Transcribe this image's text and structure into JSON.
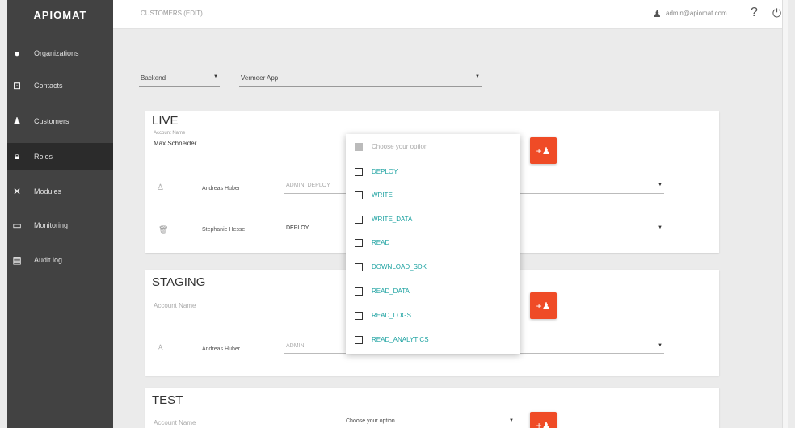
{
  "sidebar": {
    "logo": "APIOMAT",
    "items": [
      {
        "label": "Organizations",
        "icon": "●"
      },
      {
        "label": "Contacts",
        "icon": "⊡"
      },
      {
        "label": "Customers",
        "icon": "♟"
      },
      {
        "label": "Roles",
        "icon": "🔒︎"
      },
      {
        "label": "Modules",
        "icon": "✕"
      },
      {
        "label": "Monitoring",
        "icon": "▭"
      },
      {
        "label": "Audit log",
        "icon": "▤"
      }
    ],
    "active_index": 3
  },
  "header": {
    "breadcrumb": "CUSTOMERS (EDIT)",
    "user_email": "admin@apiomat.com",
    "help_icon": "?",
    "power_icon": "⏻"
  },
  "selectors": {
    "backend": "Backend",
    "app": "Vermeer App",
    "arrow": "▼"
  },
  "live": {
    "title": "LIVE",
    "account_label": "Account Name",
    "account_value": "Max Schneider",
    "rows": [
      {
        "name": "Andreas Huber",
        "role": "ADMIN, DEPLOY"
      },
      {
        "name": "Stephanie Hesse",
        "role": "DEPLOY"
      }
    ]
  },
  "staging": {
    "title": "STAGING",
    "account_placeholder": "Account Name",
    "rows": [
      {
        "name": "Andreas Huber",
        "role": "ADMIN"
      }
    ]
  },
  "test": {
    "title": "TEST",
    "account_placeholder": "Account Name",
    "role_placeholder": "Choose your option"
  },
  "dropdown": {
    "header": "Choose your option",
    "options": [
      "DEPLOY",
      "WRITE",
      "WRITE_DATA",
      "READ",
      "DOWNLOAD_SDK",
      "READ_DATA",
      "READ_LOGS",
      "READ_ANALYTICS"
    ]
  },
  "icons": {
    "add_user": "+♟",
    "person": "♙",
    "trash": "🗑︎",
    "user": "♟"
  },
  "colors": {
    "accent": "#ef4b26",
    "option_text": "#1aa1a0",
    "sidebar": "#424242"
  }
}
